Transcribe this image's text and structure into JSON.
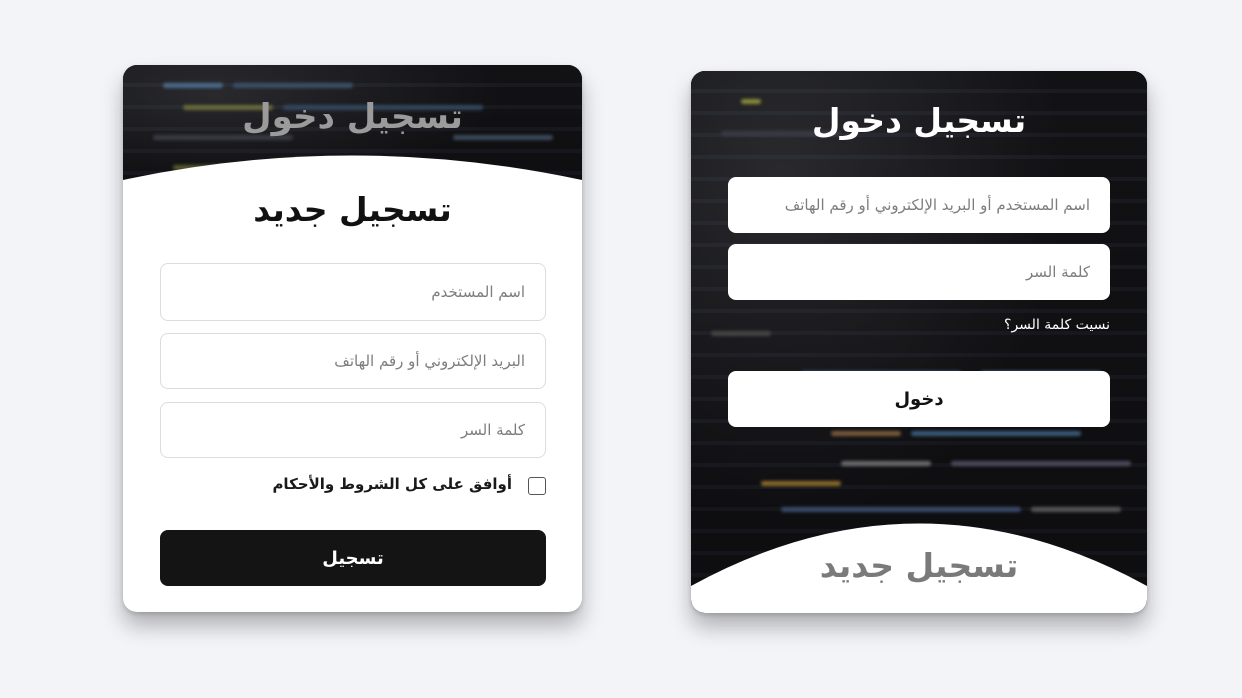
{
  "register_card": {
    "header_title": "تسجيل دخول",
    "title": "تسجيل جديد",
    "username_placeholder": "اسم المستخدم",
    "email_placeholder": "البريد الإلكتروني أو رقم الهاتف",
    "password_placeholder": "كلمة السر",
    "terms_label": "أوافق على كل الشروط والأحكام",
    "submit_label": "تسجيل"
  },
  "login_card": {
    "title": "تسجيل دخول",
    "identifier_placeholder": "اسم المستخدم أو البريد الإلكتروني أو رقم الهاتف",
    "password_placeholder": "كلمة السر",
    "forgot_label": "نسيت كلمة السر؟",
    "submit_label": "دخول",
    "footer_title": "تسجيل جديد"
  },
  "colors": {
    "page_background": "#f3f4f8",
    "dark_button": "#141414",
    "card_white": "#ffffff"
  }
}
